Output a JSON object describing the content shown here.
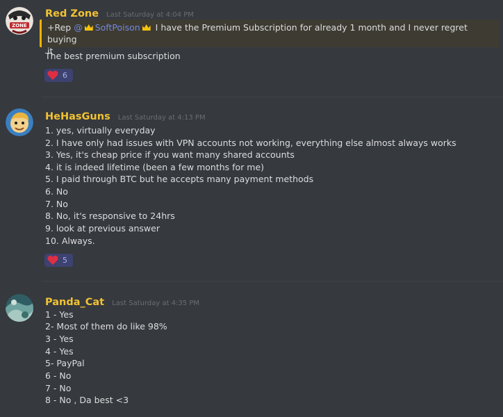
{
  "messages": [
    {
      "username": "Red Zone",
      "timestamp": "Last Saturday at 4:04 PM",
      "quote": {
        "prefix": "+Rep",
        "mention": "@",
        "mention_name": "SoftPoison",
        "text": "I have the Premium Subscription for already 1 month and I never regret buying",
        "text_cont": "it"
      },
      "lines": [
        "The best premium subscription"
      ],
      "reaction": {
        "emoji": "heart",
        "count": "6"
      }
    },
    {
      "username": "HeHasGuns",
      "timestamp": "Last Saturday at 4:13 PM",
      "lines": [
        "1. yes, virtually everyday",
        "2. I have only had issues with VPN accounts not working, everything else almost always works",
        "3. Yes, it's cheap price if you want many shared accounts",
        "4. it is indeed lifetime (been a few months for me)",
        "5. I paid through BTC but he accepts many payment methods",
        "6. No",
        "7. No",
        "8. No, it's responsive to 24hrs",
        "9. look at previous answer",
        "10. Always."
      ],
      "reaction": {
        "emoji": "heart",
        "count": "5"
      }
    },
    {
      "username": "Panda_Cat",
      "timestamp": "Last Saturday at 4:35 PM",
      "lines": [
        "1 - Yes",
        "2- Most of them do like 98%",
        "3 - Yes",
        "4 - Yes",
        "5- PayPal",
        "6 - No",
        "7 - No",
        "8 - No , Da best <3"
      ]
    }
  ],
  "colors": {
    "background": "#36393e",
    "username": "#f1c232",
    "mention": "#7289da",
    "quote_border": "#f4b400",
    "reaction_bg": "#3d4270"
  }
}
